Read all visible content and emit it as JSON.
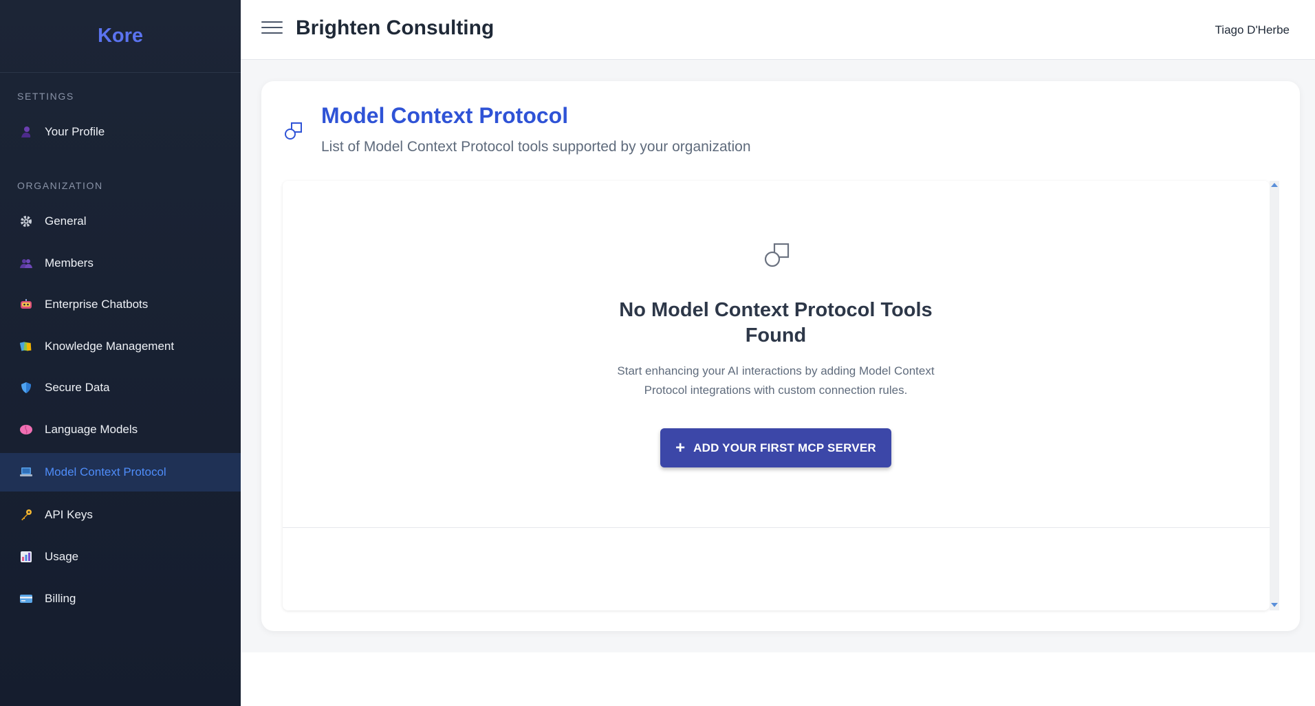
{
  "app": {
    "brand": "Kore"
  },
  "sidebar": {
    "settings_label": "SETTINGS",
    "organization_label": "ORGANIZATION",
    "items": [
      {
        "label": "Your Profile",
        "icon": "profile-icon"
      },
      {
        "label": "General",
        "icon": "gear-icon"
      },
      {
        "label": "Members",
        "icon": "members-icon"
      },
      {
        "label": "Enterprise Chatbots",
        "icon": "chatbot-icon"
      },
      {
        "label": "Knowledge Management",
        "icon": "knowledge-icon"
      },
      {
        "label": "Secure Data",
        "icon": "shield-icon"
      },
      {
        "label": "Language Models",
        "icon": "brain-icon"
      },
      {
        "label": "Model Context Protocol",
        "icon": "laptop-icon",
        "active": true
      },
      {
        "label": "API Keys",
        "icon": "key-icon"
      },
      {
        "label": "Usage",
        "icon": "chart-icon"
      },
      {
        "label": "Billing",
        "icon": "credit-card-icon"
      }
    ]
  },
  "header": {
    "organization": "Brighten Consulting",
    "user": "Tiago D'Herbe"
  },
  "page": {
    "title": "Model Context Protocol",
    "subtitle": "List of Model Context Protocol tools supported by your organization",
    "icon": "shapes-icon"
  },
  "empty_state": {
    "title": "No Model Context Protocol Tools Found",
    "description": "Start enhancing your AI interactions by adding Model Context Protocol integrations with custom connection rules.",
    "button_label": "ADD YOUR FIRST MCP SERVER",
    "button_icon": "plus-icon"
  },
  "colors": {
    "sidebar_bg": "#1c2536",
    "brand": "#5b73ef",
    "active_item_bg": "#1f3155",
    "active_item_text": "#4f8dfa",
    "title_blue": "#2f53d6",
    "cta_bg": "#3c47a8"
  }
}
